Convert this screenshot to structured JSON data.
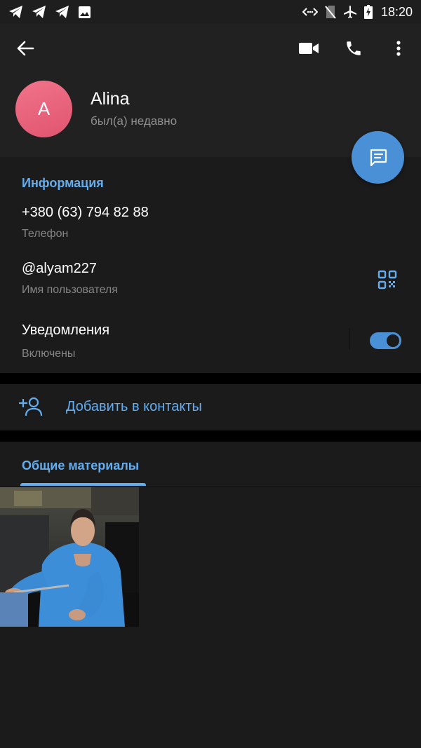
{
  "status_bar": {
    "time": "18:20"
  },
  "profile": {
    "avatar_letter": "A",
    "name": "Alina",
    "status": "был(а) недавно"
  },
  "info": {
    "section_title": "Информация",
    "phone_value": "+380 (63) 794 82 88",
    "phone_label": "Телефон",
    "username_value": "@alyam227",
    "username_label": "Имя пользователя",
    "notifications_value": "Уведомления",
    "notifications_label": "Включены",
    "notifications_enabled": true
  },
  "actions": {
    "add_contact": "Добавить в контакты"
  },
  "media": {
    "tab_label": "Общие материалы"
  },
  "colors": {
    "accent": "#64aef0",
    "fab": "#4a90d6",
    "avatar": "#e8607a",
    "background": "#1b1b1b"
  },
  "icons": {
    "status": [
      "telegram-icon",
      "telegram-icon",
      "telegram-icon",
      "image-icon",
      "data-saver-icon",
      "no-sim-icon",
      "airplane-icon",
      "battery-charging-icon"
    ],
    "appbar": [
      "back-arrow-icon",
      "video-call-icon",
      "phone-call-icon",
      "more-vert-icon"
    ],
    "fab": "message-icon",
    "qr": "qr-code-icon",
    "add_contact": "add-user-icon"
  }
}
